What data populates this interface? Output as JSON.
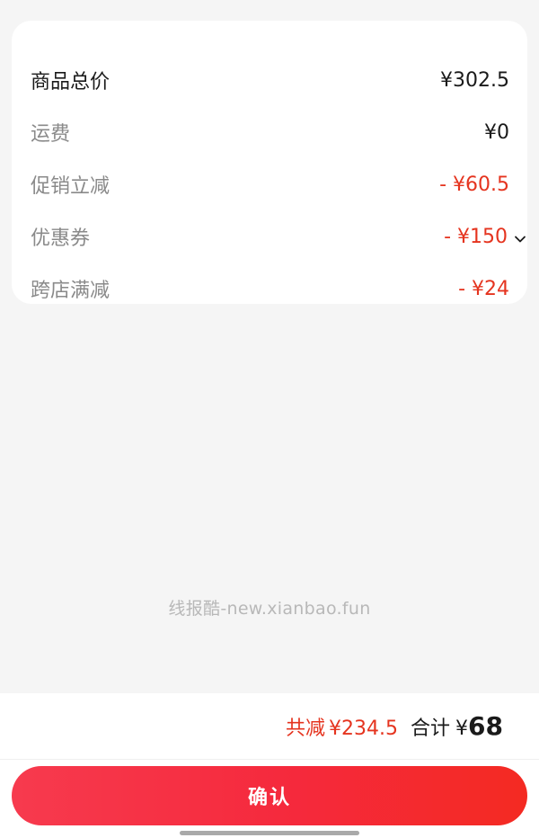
{
  "price_breakdown": {
    "items": [
      {
        "label": "商品总价",
        "value": "¥302.5"
      },
      {
        "label": "运费",
        "value": "¥0"
      },
      {
        "label": "促销立减",
        "value": "- ¥60.5"
      },
      {
        "label": "优惠券",
        "value": "- ¥150"
      },
      {
        "label": "跨店满减",
        "value": "- ¥24"
      }
    ]
  },
  "watermark": "线报酷-new.xianbao.fun",
  "summary": {
    "saved_label": "共减",
    "saved_amount": "¥234.5",
    "total_label": "合计",
    "total_currency": "¥",
    "total_amount": "68"
  },
  "confirm_button": {
    "label": "确认"
  },
  "icons": {
    "coupon_expand": "chevron-down-icon"
  },
  "colors": {
    "discount_red": "#e5341f",
    "button_gradient_start": "#f73a4e",
    "button_gradient_end": "#f42a22",
    "background": "#f5f5f5"
  }
}
